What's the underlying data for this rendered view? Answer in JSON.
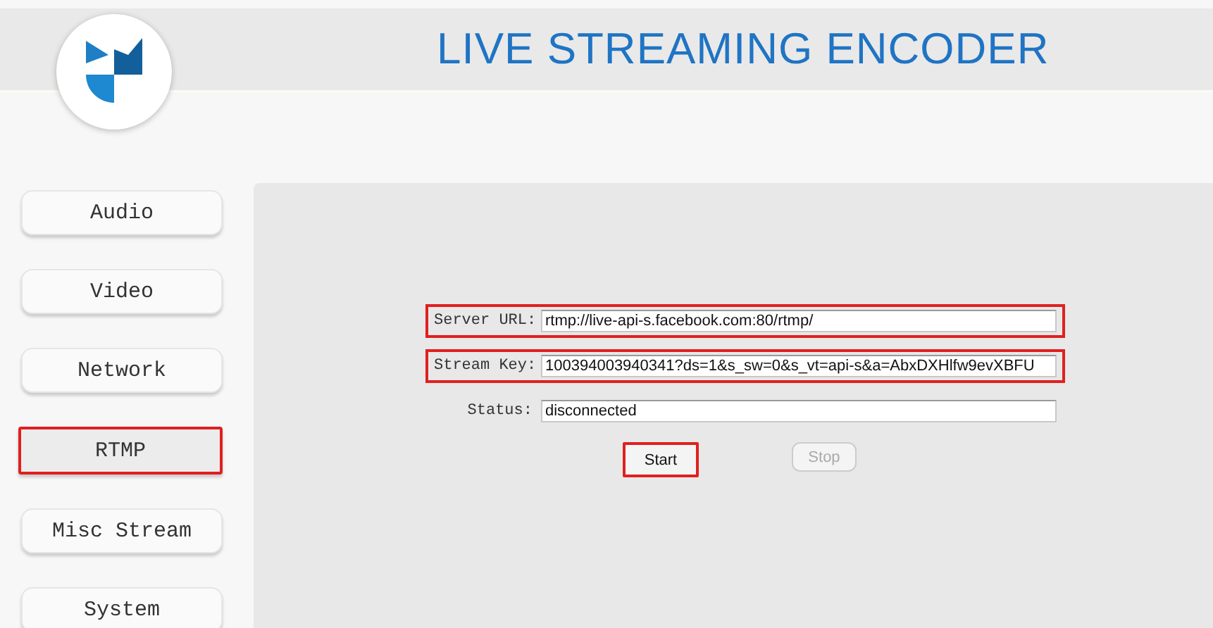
{
  "header": {
    "title": "LIVE STREAMING ENCODER"
  },
  "sidebar": {
    "items": [
      {
        "label": "Audio",
        "selected": false
      },
      {
        "label": "Video",
        "selected": false
      },
      {
        "label": "Network",
        "selected": false
      },
      {
        "label": "RTMP",
        "selected": true
      },
      {
        "label": "Misc Stream",
        "selected": false
      },
      {
        "label": "System",
        "selected": false
      }
    ]
  },
  "form": {
    "fields": [
      {
        "label": "Server URL:",
        "value": "rtmp://live-api-s.facebook.com:80/rtmp/",
        "highlighted": true
      },
      {
        "label": "Stream Key:",
        "value": "100394003940341?ds=1&s_sw=0&s_vt=api-s&a=AbxDXHlfw9evXBFU",
        "highlighted": true
      },
      {
        "label": "Status:",
        "value": "disconnected",
        "highlighted": false
      }
    ],
    "buttons": [
      {
        "label": "Start",
        "disabled": false,
        "highlighted": true
      },
      {
        "label": "Stop",
        "disabled": true,
        "highlighted": false
      }
    ]
  }
}
